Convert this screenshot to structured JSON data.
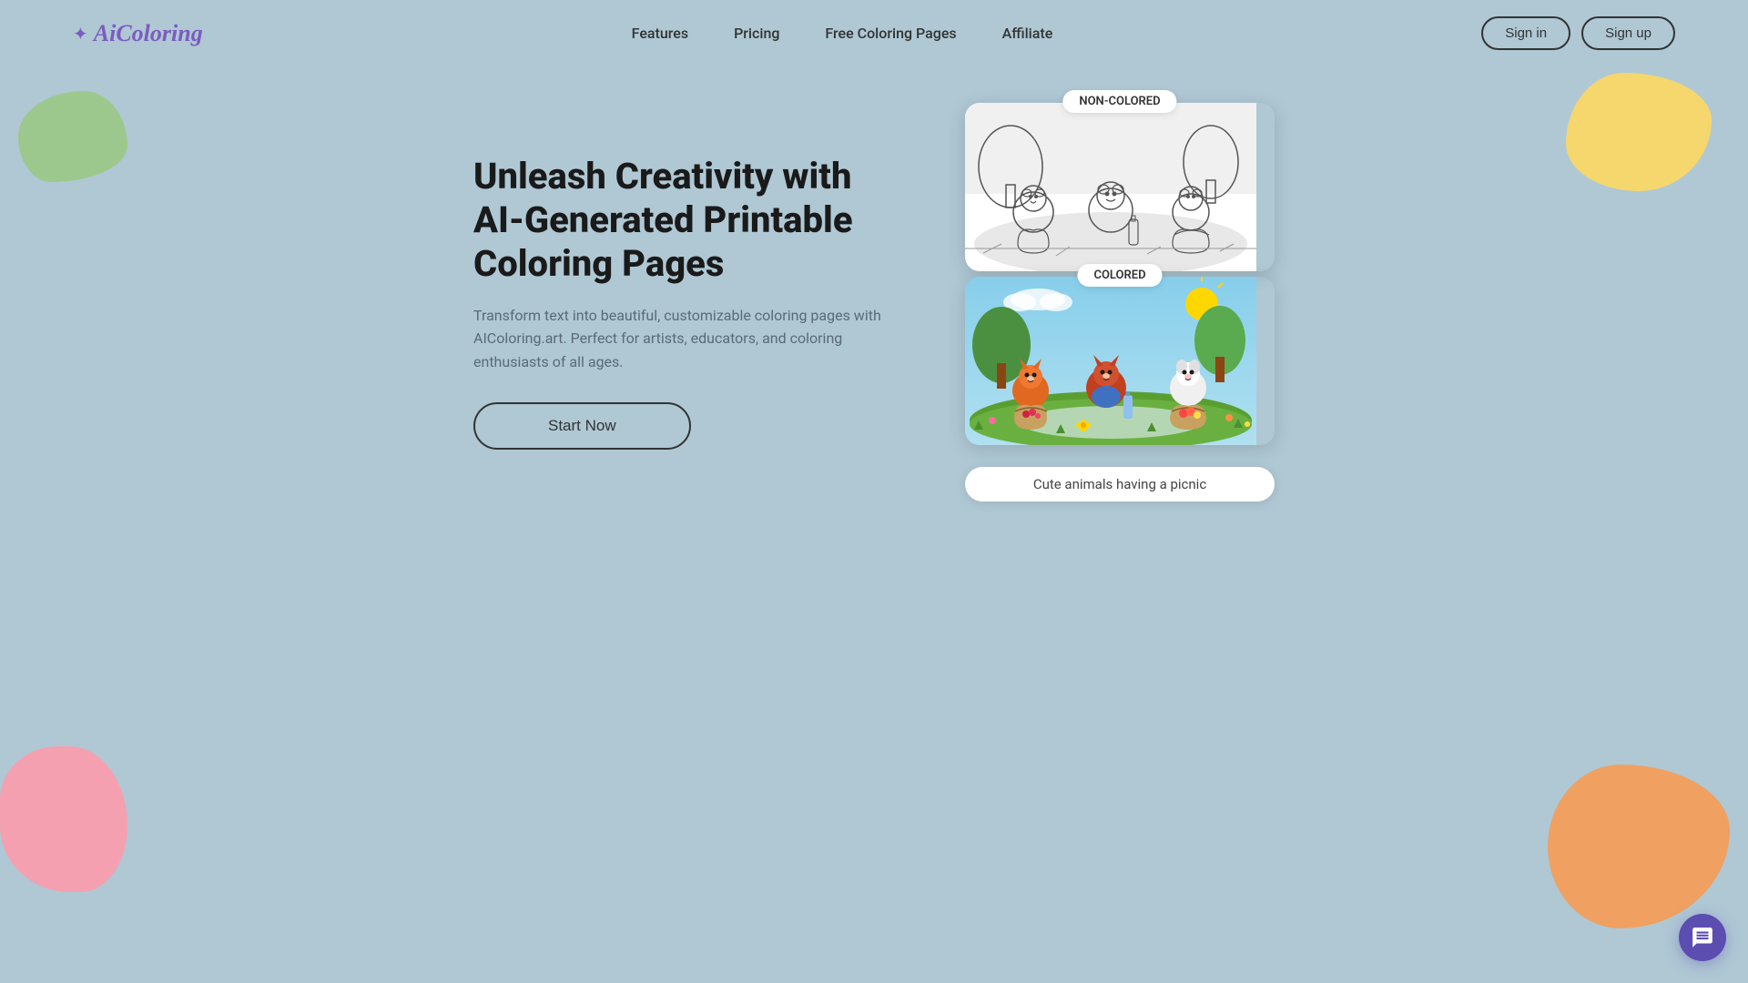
{
  "brand": {
    "name": "AiColoring",
    "logo_star": "✦"
  },
  "nav": {
    "links": [
      {
        "id": "features",
        "label": "Features"
      },
      {
        "id": "pricing",
        "label": "Pricing"
      },
      {
        "id": "free-coloring-pages",
        "label": "Free Coloring Pages"
      },
      {
        "id": "affiliate",
        "label": "Affiliate"
      }
    ],
    "signin_label": "Sign in",
    "signup_label": "Sign up"
  },
  "hero": {
    "title": "Unleash Creativity with AI-Generated Printable Coloring Pages",
    "description": "Transform text into beautiful, customizable coloring pages with AIColoring.art. Perfect for artists, educators, and coloring enthusiasts of all ages.",
    "cta_label": "Start Now"
  },
  "images": {
    "noncolored_label": "NON-COLORED",
    "colored_label": "COLORED",
    "caption": "Cute animals having a picnic"
  },
  "colors": {
    "background": "#afc8d4",
    "accent_purple": "#7c5cbf",
    "blob_green": "#9dc88d",
    "blob_yellow": "#f5d76e",
    "blob_pink": "#f4a0b0",
    "blob_orange": "#f0a060"
  }
}
